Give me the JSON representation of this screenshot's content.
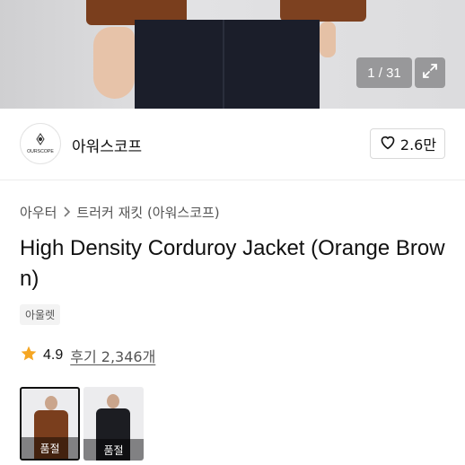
{
  "gallery": {
    "counter": "1 / 31",
    "expand_icon": "expand-icon"
  },
  "brand": {
    "logo_text": "OURSCOPE",
    "name": "아워스코프",
    "like_icon": "heart-outline-icon",
    "like_count": "2.6만"
  },
  "breadcrumb": {
    "items": [
      "아우터",
      "트러커 재킷 (아워스코프)"
    ],
    "separator_icon": "chevron-right-icon"
  },
  "product": {
    "title": "High Density Corduroy Jacket (Orange Brown)",
    "badge": "아울렛"
  },
  "rating": {
    "star_icon": "star-icon",
    "star_color": "#f5a623",
    "score": "4.9",
    "reviews_label": "후기 2,346개"
  },
  "variants": [
    {
      "label": "품절",
      "color": "#7a3e1d",
      "selected": true
    },
    {
      "label": "품절",
      "color": "#1c1d22",
      "selected": false
    }
  ]
}
